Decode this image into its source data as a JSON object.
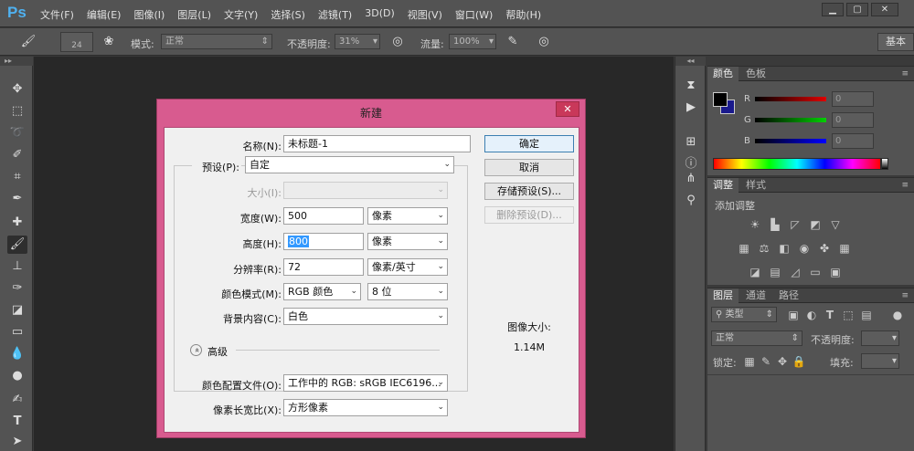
{
  "app": {
    "logo": "Ps"
  },
  "menu": [
    "文件(F)",
    "编辑(E)",
    "图像(I)",
    "图层(L)",
    "文字(Y)",
    "选择(S)",
    "滤镜(T)",
    "3D(D)",
    "视图(V)",
    "窗口(W)",
    "帮助(H)"
  ],
  "window_controls": {
    "minimize": "▁",
    "maximize": "▢",
    "close": "✕"
  },
  "options_bar": {
    "brush_size": "24",
    "mode_label": "模式:",
    "mode_value": "正常",
    "opacity_label": "不透明度:",
    "opacity_value": "31%",
    "flow_label": "流量:",
    "flow_value": "100%",
    "workspace": "基本"
  },
  "tools_header": "▸▸",
  "panels": {
    "color": {
      "tabs": [
        "颜色",
        "色板"
      ],
      "channels": [
        {
          "letter": "R",
          "value": "0",
          "color": "#c00000"
        },
        {
          "letter": "G",
          "value": "0",
          "color": "#00b000"
        },
        {
          "letter": "B",
          "value": "0",
          "color": "#0000d0"
        }
      ]
    },
    "adjustments": {
      "tabs": [
        "调整",
        "样式"
      ],
      "title": "添加调整"
    },
    "layers": {
      "tabs": [
        "图层",
        "通道",
        "路径"
      ],
      "kind_label": "类型",
      "blend_mode": "正常",
      "opacity_label": "不透明度:",
      "lock_label": "锁定:",
      "fill_label": "填充:"
    }
  },
  "dialog": {
    "title": "新建",
    "close": "✕",
    "name_label": "名称(N):",
    "name_value": "未标题-1",
    "preset_label": "预设(P):",
    "preset_value": "自定",
    "size_label": "大小(I):",
    "size_value": "",
    "width_label": "宽度(W):",
    "width_value": "500",
    "width_unit": "像素",
    "height_label": "高度(H):",
    "height_value": "800",
    "height_unit": "像素",
    "resolution_label": "分辨率(R):",
    "resolution_value": "72",
    "resolution_unit": "像素/英寸",
    "colormode_label": "颜色模式(M):",
    "colormode_value": "RGB 颜色",
    "bitdepth_value": "8 位",
    "background_label": "背景内容(C):",
    "background_value": "白色",
    "advanced_label": "高级",
    "advanced_icon": "«",
    "profile_label": "颜色配置文件(O):",
    "profile_value": "工作中的 RGB: sRGB IEC6196...",
    "aspect_label": "像素长宽比(X):",
    "aspect_value": "方形像素",
    "ok": "确定",
    "cancel": "取消",
    "save_preset": "存储预设(S)...",
    "delete_preset": "删除预设(D)...",
    "image_size_label": "图像大小:",
    "image_size_value": "1.14M"
  }
}
